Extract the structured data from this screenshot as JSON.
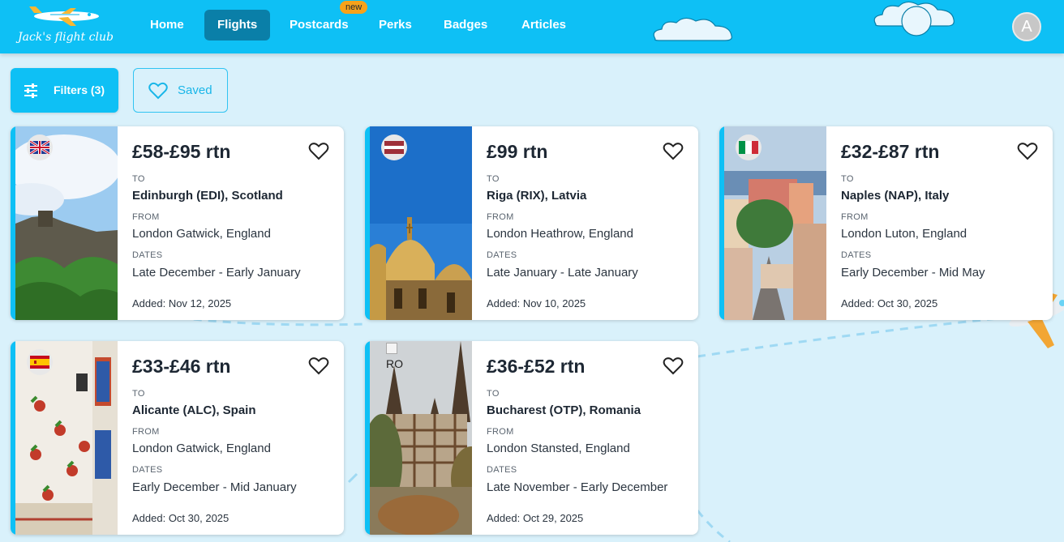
{
  "header": {
    "logo_text": "Jack's flight club",
    "nav": [
      {
        "label": "Home",
        "active": false
      },
      {
        "label": "Flights",
        "active": true
      },
      {
        "label": "Postcards",
        "active": false
      },
      {
        "label": "Perks",
        "active": false
      },
      {
        "label": "Badges",
        "active": false
      },
      {
        "label": "Articles",
        "active": false
      }
    ],
    "new_badge": "new",
    "avatar_initial": "A"
  },
  "toolbar": {
    "filters_label": "Filters (3)",
    "saved_label": "Saved"
  },
  "labels": {
    "to": "TO",
    "from": "FROM",
    "dates": "DATES"
  },
  "cards": [
    {
      "price": "£58-£95 rtn",
      "to": "Edinburgh (EDI), Scotland",
      "from": "London Gatwick, England",
      "dates": "Late December - Early January",
      "added": "Added: Nov 12, 2025",
      "flag": "uk-flag-icon"
    },
    {
      "price": "£99 rtn",
      "to": "Riga (RIX), Latvia",
      "from": "London Heathrow, England",
      "dates": "Late January - Late January",
      "added": "Added: Nov 10, 2025",
      "flag": "latvia-flag-icon"
    },
    {
      "price": "£32-£87 rtn",
      "to": "Naples (NAP), Italy",
      "from": "London Luton, England",
      "dates": "Early December - Mid May",
      "added": "Added: Oct 30, 2025",
      "flag": "italy-flag-icon"
    },
    {
      "price": "£33-£46 rtn",
      "to": "Alicante (ALC), Spain",
      "from": "London Gatwick, England",
      "dates": "Early December - Mid January",
      "added": "Added: Oct 30, 2025",
      "flag": "spain-flag-icon"
    },
    {
      "price": "£36-£52 rtn",
      "to": "Bucharest (OTP), Romania",
      "from": "London Stansted, England",
      "dates": "Late November - Early December",
      "added": "Added: Oct 29, 2025",
      "flag_alt": "RO"
    }
  ],
  "colors": {
    "brand": "#0ec0f5",
    "active_nav": "#0a7fa8",
    "badge": "#f7a21b",
    "page_bg": "#d9f1fb"
  }
}
